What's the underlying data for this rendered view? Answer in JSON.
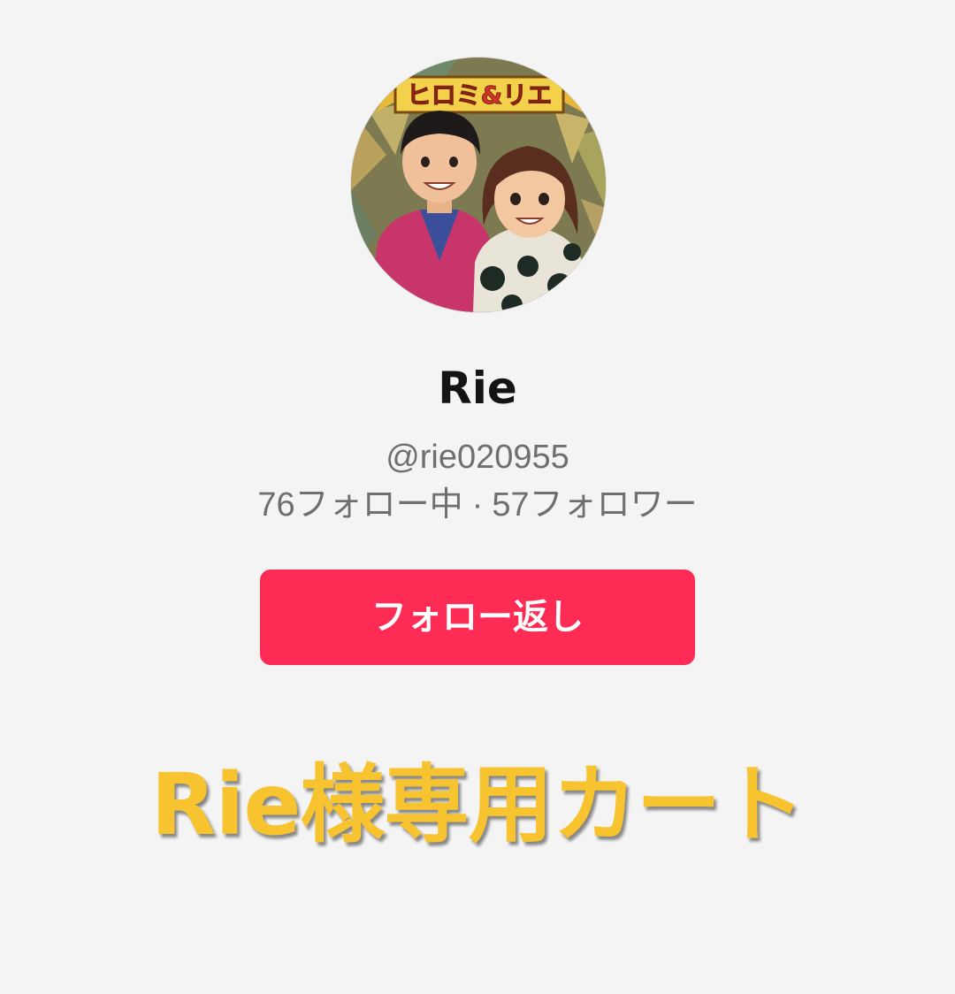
{
  "profile": {
    "avatar_banner_text": "ヒロミ&リエ",
    "display_name": "Rie",
    "username": "@rie020955",
    "following_count": "76",
    "following_label": "フォロー中",
    "separator": "·",
    "followers_count": "57",
    "followers_label": "フォロワー"
  },
  "follow_button": {
    "label": "フォロー返し",
    "color": "#fe2c55"
  },
  "overlay": {
    "text": "Rie様専用カート",
    "color": "#f7c32e"
  }
}
